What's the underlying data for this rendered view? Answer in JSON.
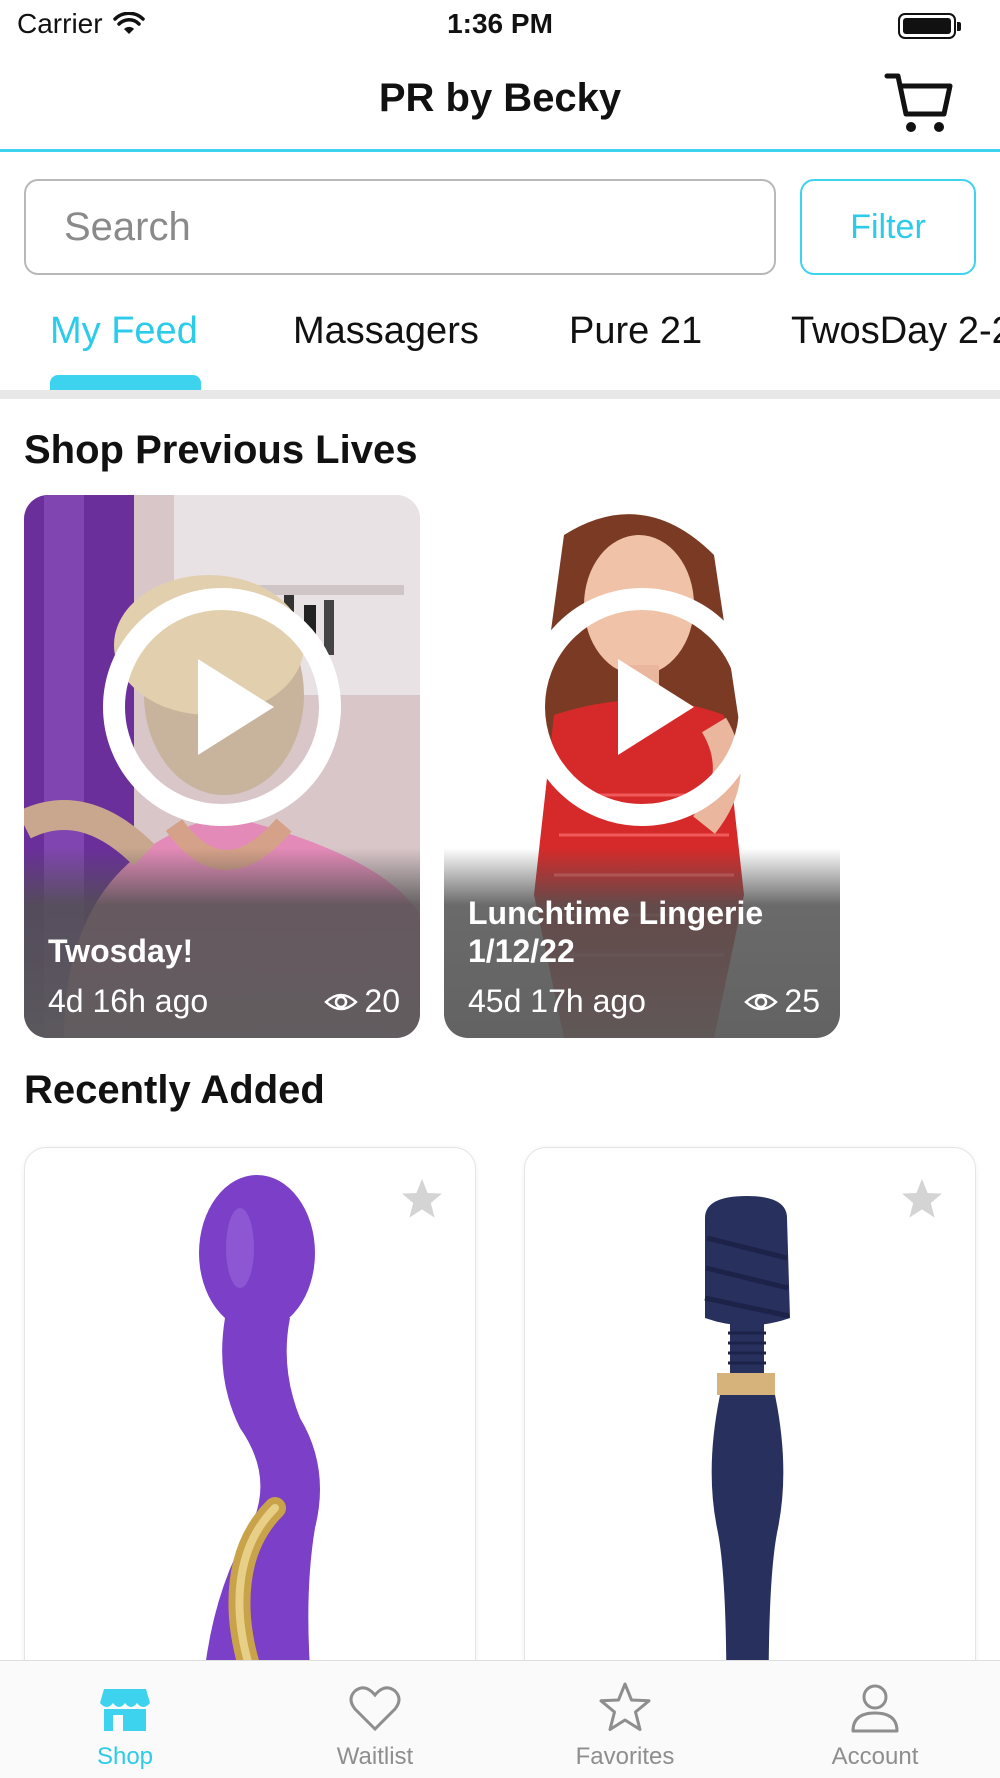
{
  "status_bar": {
    "carrier": "Carrier",
    "time": "1:36 PM"
  },
  "nav": {
    "title": "PR by Becky",
    "cart_icon": "cart-icon"
  },
  "search": {
    "placeholder": "Search",
    "value": "",
    "filter_label": "Filter"
  },
  "tabs": [
    {
      "label": "My Feed",
      "active": true
    },
    {
      "label": "Massagers",
      "active": false
    },
    {
      "label": "Pure 21",
      "active": false
    },
    {
      "label": "TwosDay 2-2"
    }
  ],
  "previous_lives": {
    "title": "Shop Previous Lives",
    "items": [
      {
        "title": "Twosday!",
        "age": "4d 16h ago",
        "views": "20"
      },
      {
        "title": "Lunchtime Lingerie 1/12/22",
        "age": "45d 17h ago",
        "views": "25"
      }
    ]
  },
  "recently_added": {
    "title": "Recently Added",
    "products": [
      {
        "favorite": false,
        "color": "#7b3fc8"
      },
      {
        "favorite": false,
        "color": "#28305e"
      }
    ]
  },
  "tab_bar": {
    "items": [
      {
        "label": "Shop",
        "icon": "shop-icon",
        "active": true
      },
      {
        "label": "Waitlist",
        "icon": "heart-icon",
        "active": false
      },
      {
        "label": "Favorites",
        "icon": "star-icon",
        "active": false
      },
      {
        "label": "Account",
        "icon": "account-icon",
        "active": false
      }
    ]
  },
  "colors": {
    "accent": "#3dd3ef",
    "accent_text": "#2ccbe9"
  }
}
